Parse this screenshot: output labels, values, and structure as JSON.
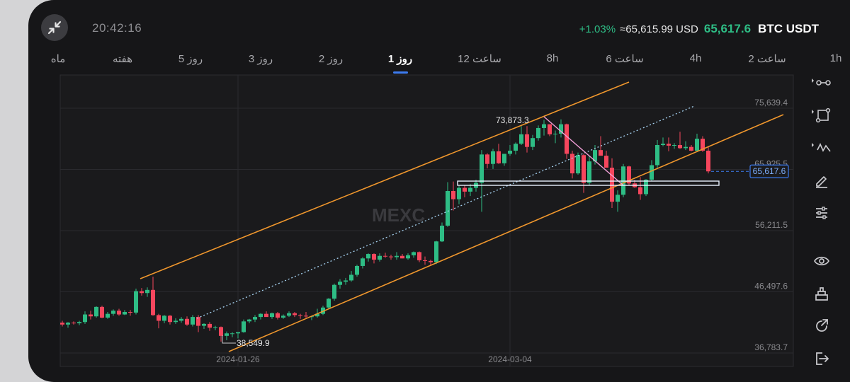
{
  "header": {
    "time": "20:42:16",
    "change_pct": "+1.03%",
    "usd_price": "≈65,615.99 USD",
    "last_price": "65,617.6",
    "pair": "BTC USDT"
  },
  "timeframes": [
    {
      "label": "ماه",
      "active": false
    },
    {
      "label": "هفته",
      "active": false
    },
    {
      "label": "5 روز",
      "active": false
    },
    {
      "label": "3 روز",
      "active": false
    },
    {
      "label": "2 روز",
      "active": false
    },
    {
      "label": "1 روز",
      "active": true
    },
    {
      "label": "12 ساعت",
      "active": false
    },
    {
      "label": "8h",
      "active": false
    },
    {
      "label": "6 ساعت",
      "active": false
    },
    {
      "label": "4h",
      "active": false
    },
    {
      "label": "2 ساعت",
      "active": false
    },
    {
      "label": "1h",
      "active": false
    }
  ],
  "chart": {
    "watermark": "MEXC",
    "price_labels": [
      "75,639.4",
      "65,925.5",
      "56,211.5",
      "46,497.6",
      "36,783.7"
    ],
    "date_labels": [
      "2024-01-26",
      "2024-03-04"
    ],
    "current_price_tag": "65,617.6",
    "high_annotation": "73,873.3",
    "low_annotation": "38,549.9",
    "colors": {
      "up": "#2ebd85",
      "down": "#f6465d",
      "channel": "#f0972d",
      "trend_dotted": "#a7d3f2",
      "box": "#e8f1ff",
      "pink_line": "#f2a0d8",
      "price_tag": "#3d7cf0"
    }
  },
  "chart_data": {
    "type": "candlestick",
    "symbol": "BTC USDT",
    "interval": "1 روز",
    "y_axis_ticks": [
      75639.4,
      65925.5,
      56211.5,
      46497.6,
      36783.7
    ],
    "x_axis_ticks": [
      "2024-01-26",
      "2024-03-04"
    ],
    "last_price": 65617.6,
    "annotations": {
      "high": 73873.3,
      "low": 38549.9
    },
    "candles": [
      [
        41600,
        41900,
        41000,
        41300
      ],
      [
        41300,
        41700,
        40800,
        41600
      ],
      [
        41600,
        41800,
        41300,
        41500
      ],
      [
        41500,
        41900,
        41200,
        41700
      ],
      [
        41700,
        43400,
        41400,
        42900
      ],
      [
        42900,
        43500,
        42100,
        42600
      ],
      [
        42600,
        44200,
        42400,
        44100
      ],
      [
        44100,
        44300,
        42300,
        42400
      ],
      [
        42400,
        43300,
        42200,
        43000
      ],
      [
        43000,
        43700,
        42700,
        43500
      ],
      [
        43500,
        43800,
        42700,
        42900
      ],
      [
        42900,
        43600,
        42800,
        43300
      ],
      [
        43300,
        43600,
        42700,
        43200
      ],
      [
        43200,
        47000,
        42900,
        46600
      ],
      [
        46600,
        47100,
        45900,
        46300
      ],
      [
        46300,
        47200,
        45700,
        46800
      ],
      [
        46800,
        48900,
        42700,
        42800
      ],
      [
        42800,
        43000,
        40700,
        41900
      ],
      [
        41900,
        42800,
        41500,
        42700
      ],
      [
        42700,
        42800,
        41300,
        41700
      ],
      [
        41700,
        42300,
        41400,
        41900
      ],
      [
        41900,
        42500,
        41600,
        42200
      ],
      [
        42200,
        42600,
        41100,
        41300
      ],
      [
        41300,
        42800,
        41000,
        42500
      ],
      [
        42500,
        42800,
        40100,
        41100
      ],
      [
        41100,
        41500,
        40600,
        41400
      ],
      [
        41400,
        41700,
        40300,
        40800
      ],
      [
        40800,
        41100,
        40400,
        40900
      ],
      [
        40900,
        41000,
        38600,
        39500
      ],
      [
        39500,
        40200,
        38800,
        39900
      ],
      [
        39900,
        40100,
        39300,
        39900
      ],
      [
        39900,
        40000,
        39100,
        40100
      ],
      [
        40100,
        42100,
        40000,
        41800
      ],
      [
        41800,
        42200,
        41500,
        42100
      ],
      [
        42100,
        42800,
        41700,
        42500
      ],
      [
        42500,
        43100,
        42100,
        43000
      ],
      [
        43000,
        43400,
        42600,
        42500
      ],
      [
        42500,
        43200,
        42200,
        43100
      ],
      [
        43100,
        43300,
        42100,
        42400
      ],
      [
        42400,
        42900,
        42200,
        42700
      ],
      [
        42700,
        43400,
        42500,
        43100
      ],
      [
        43100,
        43300,
        42500,
        42800
      ],
      [
        42800,
        43000,
        42200,
        42700
      ],
      [
        42700,
        43300,
        42400,
        42600
      ],
      [
        42600,
        42700,
        42000,
        42600
      ],
      [
        42600,
        43800,
        42400,
        43000
      ],
      [
        43000,
        44300,
        42800,
        44000
      ],
      [
        44000,
        45500,
        43800,
        45400
      ],
      [
        45400,
        47800,
        45100,
        47600
      ],
      [
        47600,
        48500,
        47000,
        48100
      ],
      [
        48100,
        48700,
        47600,
        48300
      ],
      [
        48300,
        49800,
        48100,
        49200
      ],
      [
        49200,
        50800,
        48900,
        50600
      ],
      [
        50600,
        52000,
        50200,
        51800
      ],
      [
        51800,
        52600,
        51300,
        52500
      ],
      [
        52500,
        52600,
        51000,
        51600
      ],
      [
        51600,
        52600,
        51300,
        52200
      ],
      [
        52200,
        52700,
        51900,
        52100
      ],
      [
        52100,
        52400,
        51600,
        52000
      ],
      [
        52000,
        52800,
        51600,
        52200
      ],
      [
        52200,
        52500,
        51800,
        51800
      ],
      [
        51800,
        52600,
        51600,
        52300
      ],
      [
        52300,
        52900,
        51900,
        52800
      ],
      [
        52800,
        52900,
        51200,
        51500
      ],
      [
        51500,
        52100,
        50800,
        51400
      ],
      [
        51400,
        51600,
        50600,
        51200
      ],
      [
        51200,
        54600,
        50900,
        54500
      ],
      [
        54500,
        57500,
        54400,
        57000
      ],
      [
        57000,
        63900,
        56800,
        62500
      ],
      [
        62500,
        64000,
        59400,
        61200
      ],
      [
        61200,
        63300,
        60400,
        63000
      ],
      [
        63000,
        63400,
        61500,
        62400
      ],
      [
        62400,
        63600,
        61700,
        63000
      ],
      [
        63000,
        64300,
        62400,
        63800
      ],
      [
        63800,
        69000,
        59200,
        68300
      ],
      [
        68300,
        68500,
        66100,
        66800
      ],
      [
        66800,
        69200,
        66000,
        68800
      ],
      [
        68800,
        70000,
        66800,
        66900
      ],
      [
        66900,
        68000,
        66500,
        68400
      ],
      [
        68400,
        69800,
        68100,
        68900
      ],
      [
        68900,
        70200,
        68300,
        70000
      ],
      [
        70000,
        72800,
        69800,
        71500
      ],
      [
        71500,
        72800,
        68600,
        69500
      ],
      [
        69500,
        71400,
        69000,
        70900
      ],
      [
        70900,
        72900,
        70500,
        72500
      ],
      [
        72500,
        73800,
        71300,
        73100
      ],
      [
        73100,
        73100,
        71200,
        71500
      ],
      [
        71500,
        72100,
        70100,
        71600
      ],
      [
        71600,
        73873,
        71000,
        73100
      ],
      [
        73100,
        73200,
        67600,
        68400
      ],
      [
        68400,
        68900,
        64500,
        65300
      ],
      [
        65300,
        68600,
        65100,
        68200
      ],
      [
        68200,
        68400,
        62200,
        63800
      ],
      [
        63800,
        68000,
        63400,
        67200
      ],
      [
        67200,
        69800,
        66700,
        69000
      ],
      [
        69000,
        71200,
        68400,
        68100
      ],
      [
        68100,
        68900,
        67200,
        66200
      ],
      [
        66200,
        67700,
        59800,
        60800
      ],
      [
        60800,
        62600,
        59200,
        61900
      ],
      [
        61900,
        66800,
        61500,
        66400
      ],
      [
        66400,
        66500,
        63400,
        63700
      ],
      [
        63700,
        64300,
        63000,
        63100
      ],
      [
        63100,
        64700,
        61100,
        62000
      ],
      [
        62000,
        64400,
        61700,
        64300
      ],
      [
        64300,
        67400,
        64100,
        66600
      ],
      [
        66600,
        70600,
        66100,
        69800
      ],
      [
        69800,
        71000,
        69600,
        70000
      ],
      [
        70000,
        71000,
        68800,
        69700
      ],
      [
        69700,
        70100,
        69200,
        69800
      ],
      [
        69800,
        71900,
        69200,
        69300
      ],
      [
        69300,
        70400,
        69000,
        69500
      ],
      [
        69500,
        69800,
        68800,
        68900
      ],
      [
        68900,
        71600,
        68800,
        70800
      ],
      [
        70800,
        71200,
        68700,
        68900
      ],
      [
        68900,
        69600,
        65300,
        65617.6
      ]
    ]
  }
}
